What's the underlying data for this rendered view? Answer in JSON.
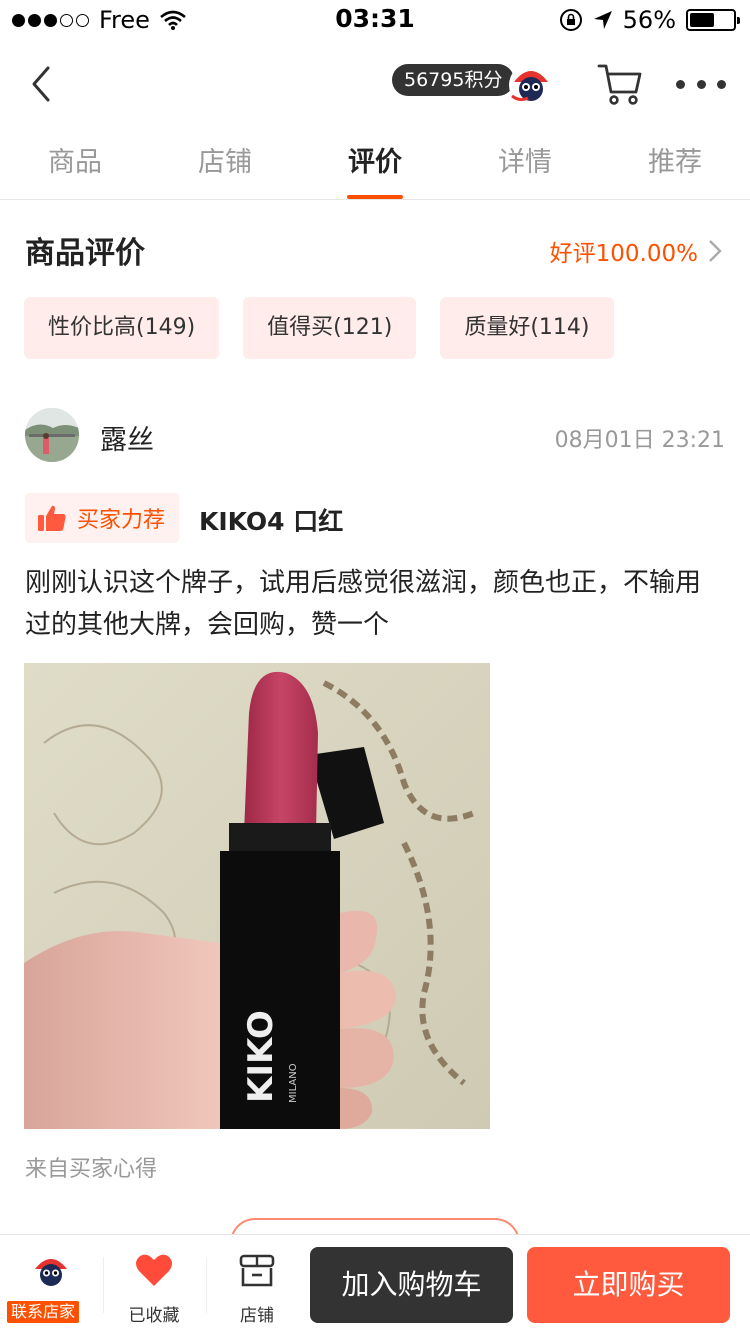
{
  "status_bar": {
    "carrier": "Free",
    "time": "03:31",
    "battery": "56%",
    "battery_level": 0.56
  },
  "navbar": {
    "points": "56795积分"
  },
  "tabs": [
    {
      "label": "商品"
    },
    {
      "label": "店铺"
    },
    {
      "label": "评价"
    },
    {
      "label": "详情"
    },
    {
      "label": "推荐"
    }
  ],
  "active_tab": "评价",
  "reviews_section": {
    "title": "商品评价",
    "good_rate": "好评100.00%",
    "tags": [
      {
        "label": "性价比高(149)"
      },
      {
        "label": "值得买(121)"
      },
      {
        "label": "质量好(114)"
      }
    ]
  },
  "review": {
    "reviewer": "露丝",
    "date": "08月01日 23:21",
    "badge": "买家力荐",
    "product": "KIKO4 口红",
    "text": "刚刚认识这个牌子，试用后感觉很滋润，颜色也正，不输用过的其他大牌，会回购，赞一个",
    "photo_brand_text": "KIKO",
    "photo_brand_sub": "MILANO",
    "source": "来自买家心得"
  },
  "bottom_bar": {
    "contact": "联系店家",
    "favorite": "已收藏",
    "shop": "店铺",
    "add_to_cart": "加入购物车",
    "buy_now": "立即购买"
  },
  "colors": {
    "accent": "#ff5000",
    "buy_button": "#ff5a3d",
    "cart_button": "#333333",
    "tag_bg": "#ffeceb"
  }
}
